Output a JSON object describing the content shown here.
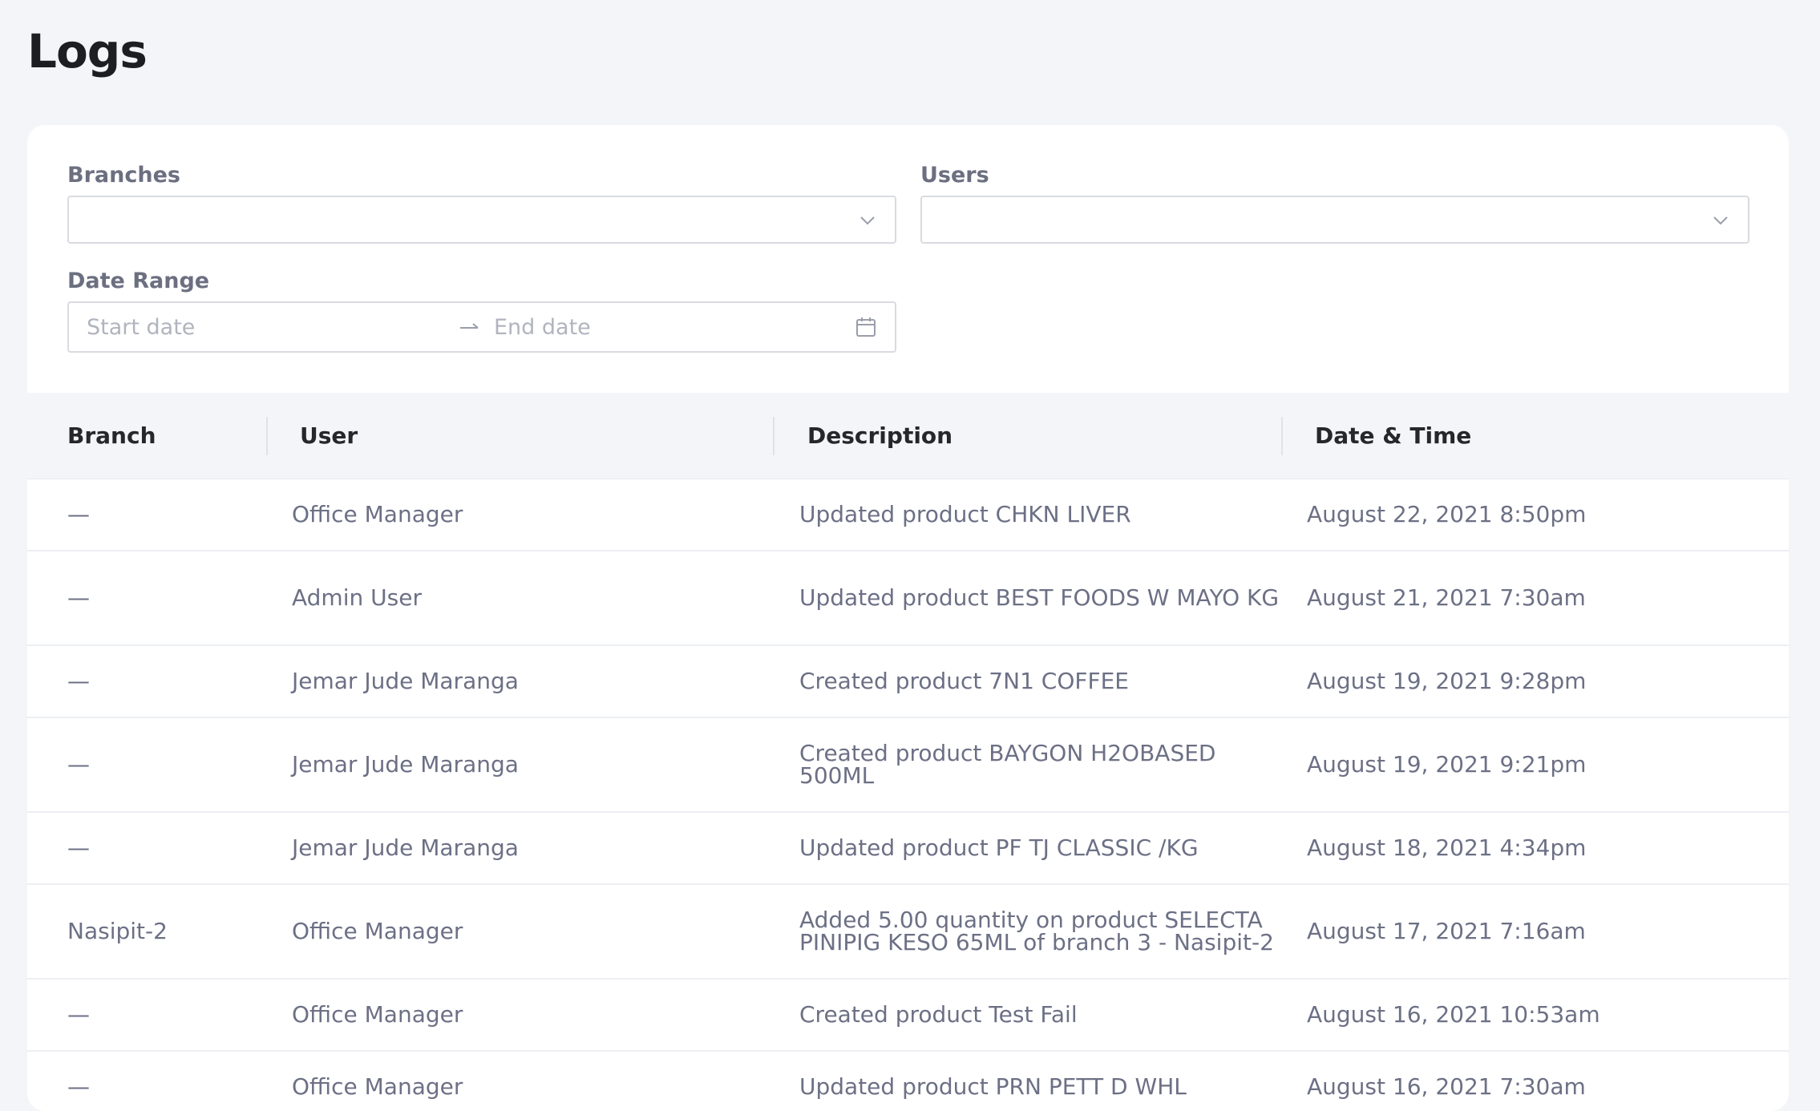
{
  "page": {
    "title": "Logs"
  },
  "filters": {
    "branches": {
      "label": "Branches",
      "value": ""
    },
    "users": {
      "label": "Users",
      "value": ""
    },
    "date_range": {
      "label": "Date Range",
      "start_placeholder": "Start date",
      "end_placeholder": "End date"
    }
  },
  "table": {
    "columns": [
      "Branch",
      "User",
      "Description",
      "Date & Time"
    ],
    "rows": [
      {
        "branch": "—",
        "user": "Office Manager",
        "description": "Updated product CHKN LIVER",
        "datetime": "August 22, 2021 8:50pm"
      },
      {
        "branch": "—",
        "user": "Admin User",
        "description": "Updated product BEST FOODS W MAYO KG",
        "datetime": "August 21, 2021 7:30am"
      },
      {
        "branch": "—",
        "user": "Jemar Jude Maranga",
        "description": "Created product 7N1 COFFEE",
        "datetime": "August 19, 2021 9:28pm"
      },
      {
        "branch": "—",
        "user": "Jemar Jude Maranga",
        "description": "Created product BAYGON H2OBASED 500ML",
        "datetime": "August 19, 2021 9:21pm"
      },
      {
        "branch": "—",
        "user": "Jemar Jude Maranga",
        "description": "Updated product PF TJ CLASSIC /KG",
        "datetime": "August 18, 2021 4:34pm"
      },
      {
        "branch": "Nasipit-2",
        "user": "Office Manager",
        "description": "Added 5.00 quantity on product SELECTA PINIPIG KESO 65ML of branch 3 - Nasipit-2",
        "datetime": "August 17, 2021 7:16am"
      },
      {
        "branch": "—",
        "user": "Office Manager",
        "description": "Created product Test Fail",
        "datetime": "August 16, 2021 10:53am"
      },
      {
        "branch": "—",
        "user": "Office Manager",
        "description": "Updated product PRN PETT D WHL",
        "datetime": "August 16, 2021 7:30am"
      }
    ]
  },
  "colors": {
    "background": "#f4f5f8",
    "card": "#ffffff",
    "text_muted": "#6c7085",
    "border": "#d9dbe1"
  },
  "icons": [
    "chevron-down-icon",
    "arrow-right-icon",
    "calendar-icon"
  ]
}
